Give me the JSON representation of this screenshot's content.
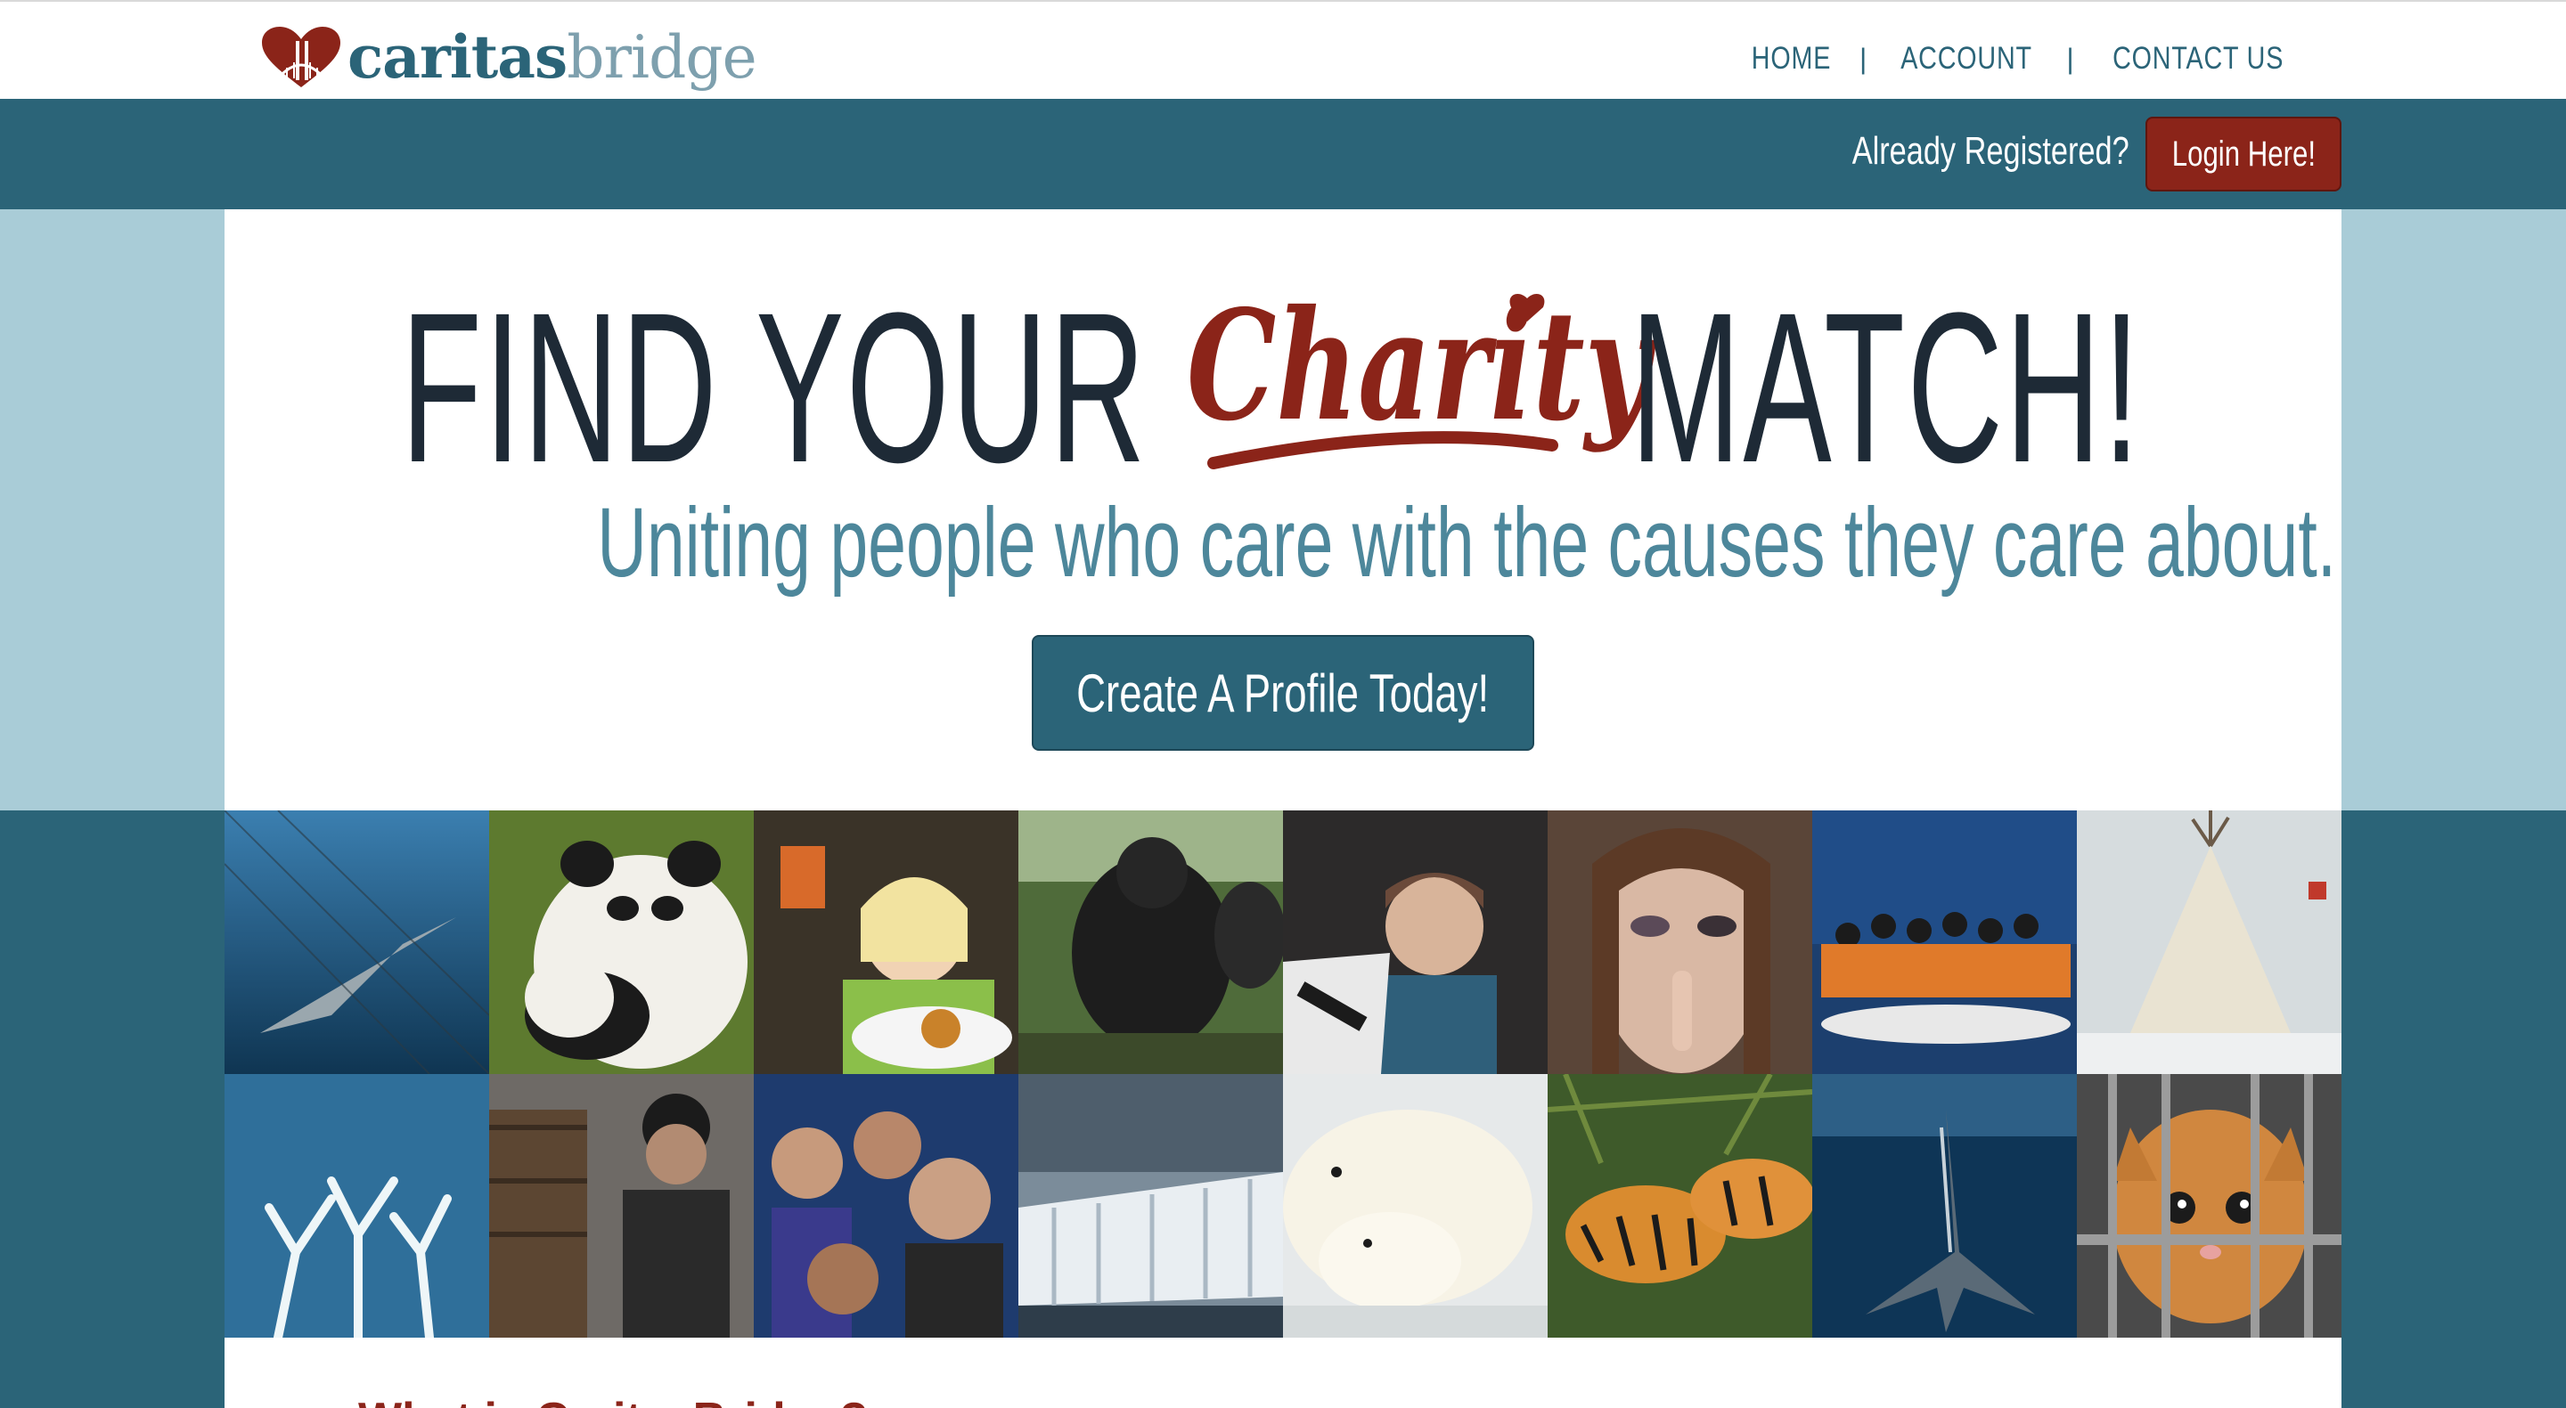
{
  "header": {
    "logo": {
      "text_bold": "caritas",
      "text_light": "bridge",
      "icon": "heart-bridge-logo-icon"
    },
    "nav": [
      {
        "label": "HOME"
      },
      {
        "label": "ACCOUNT"
      },
      {
        "label": "CONTACT US"
      }
    ]
  },
  "login_bar": {
    "prompt": "Already Registered?",
    "button_label": "Login Here!"
  },
  "hero": {
    "headline_left": "FIND YOUR",
    "headline_script": "Charity",
    "headline_right": "MATCH!",
    "tagline": "Uniting people who care with the causes they care about.",
    "cta_label": "Create A Profile Today!"
  },
  "photo_grid": [
    {
      "subject": "shark-in-net"
    },
    {
      "subject": "pandas"
    },
    {
      "subject": "child-with-food"
    },
    {
      "subject": "gorilla"
    },
    {
      "subject": "refugee-child"
    },
    {
      "subject": "woman-bruised-face"
    },
    {
      "subject": "migrant-boat"
    },
    {
      "subject": "tipi-camp"
    },
    {
      "subject": "bleached-coral"
    },
    {
      "subject": "homeless-man"
    },
    {
      "subject": "children-crowd"
    },
    {
      "subject": "melting-glacier"
    },
    {
      "subject": "polar-bears"
    },
    {
      "subject": "tigers"
    },
    {
      "subject": "whale-tail"
    },
    {
      "subject": "caged-cat"
    }
  ],
  "below_fold": {
    "title": "What is CaritasBridge?"
  },
  "colors": {
    "teal": "#2b6478",
    "light_teal": "#a9ccd7",
    "brand_red": "#8b2419",
    "dark_text": "#1e2a36",
    "tagline": "#4d879b"
  }
}
